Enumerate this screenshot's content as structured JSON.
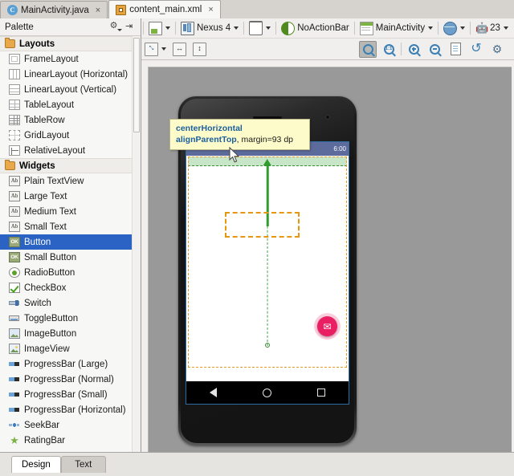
{
  "editor_tabs": [
    {
      "label": "MainActivity.java",
      "icon": "java-class-icon",
      "active": false,
      "close": "×"
    },
    {
      "label": "content_main.xml",
      "icon": "xml-layout-icon",
      "active": true,
      "close": "×"
    }
  ],
  "palette": {
    "title": "Palette",
    "gear_icon": "⚙",
    "collapse_icon": "⇥",
    "groups": [
      {
        "label": "Layouts",
        "items": [
          {
            "label": "FrameLayout",
            "icon": "framelayout-icon",
            "style": "ic-frame",
            "glyph": ""
          },
          {
            "label": "LinearLayout (Horizontal)",
            "icon": "linearlayout-horizontal-icon",
            "style": "ic-linh",
            "glyph": ""
          },
          {
            "label": "LinearLayout (Vertical)",
            "icon": "linearlayout-vertical-icon",
            "style": "ic-linv",
            "glyph": ""
          },
          {
            "label": "TableLayout",
            "icon": "tablelayout-icon",
            "style": "ic-tablay",
            "glyph": ""
          },
          {
            "label": "TableRow",
            "icon": "tablerow-icon",
            "style": "ic-tabrow",
            "glyph": ""
          },
          {
            "label": "GridLayout",
            "icon": "gridlayout-icon",
            "style": "ic-grid",
            "glyph": ""
          },
          {
            "label": "RelativeLayout",
            "icon": "relativelayout-icon",
            "style": "ic-rel",
            "glyph": ""
          }
        ]
      },
      {
        "label": "Widgets",
        "items": [
          {
            "label": "Plain TextView",
            "icon": "text-ab-icon",
            "style": "ic-ab",
            "glyph": "Ab"
          },
          {
            "label": "Large Text",
            "icon": "text-ab-icon",
            "style": "ic-ab",
            "glyph": "Ab"
          },
          {
            "label": "Medium Text",
            "icon": "text-ab-icon",
            "style": "ic-ab",
            "glyph": "Ab"
          },
          {
            "label": "Small Text",
            "icon": "text-ab-icon",
            "style": "ic-ab",
            "glyph": "Ab"
          },
          {
            "label": "Button",
            "icon": "button-ok-icon",
            "style": "ic-ok",
            "glyph": "OK",
            "selected": true
          },
          {
            "label": "Small Button",
            "icon": "button-ok-icon",
            "style": "ic-ok",
            "glyph": "OK"
          },
          {
            "label": "RadioButton",
            "icon": "radiobutton-icon",
            "style": "ic-radio",
            "glyph": ""
          },
          {
            "label": "CheckBox",
            "icon": "checkbox-icon",
            "style": "ic-check",
            "glyph": ""
          },
          {
            "label": "Switch",
            "icon": "switch-icon",
            "style": "ic-switch",
            "glyph": ""
          },
          {
            "label": "ToggleButton",
            "icon": "togglebutton-icon",
            "style": "ic-toggle",
            "glyph": ""
          },
          {
            "label": "ImageButton",
            "icon": "imagebutton-icon",
            "style": "ic-imgbtn",
            "glyph": ""
          },
          {
            "label": "ImageView",
            "icon": "imageview-icon",
            "style": "ic-imgview",
            "glyph": ""
          },
          {
            "label": "ProgressBar (Large)",
            "icon": "progressbar-icon",
            "style": "ic-prog",
            "glyph": ""
          },
          {
            "label": "ProgressBar (Normal)",
            "icon": "progressbar-icon",
            "style": "ic-prog",
            "glyph": ""
          },
          {
            "label": "ProgressBar (Small)",
            "icon": "progressbar-icon",
            "style": "ic-prog",
            "glyph": ""
          },
          {
            "label": "ProgressBar (Horizontal)",
            "icon": "progressbar-icon",
            "style": "ic-prog",
            "glyph": ""
          },
          {
            "label": "SeekBar",
            "icon": "seekbar-icon",
            "style": "ic-seek",
            "glyph": ""
          },
          {
            "label": "RatingBar",
            "icon": "ratingbar-icon",
            "style": "ic-rating",
            "glyph": "★"
          }
        ]
      }
    ]
  },
  "design_toolbar": {
    "layout_variant": {
      "label": "",
      "icon": "layout-variant-icon",
      "caret": true
    },
    "device": {
      "label": "Nexus 4",
      "icon": "device-icon",
      "caret": true
    },
    "orientation": {
      "label": "",
      "icon": "orientation-icon",
      "caret": true
    },
    "theme": {
      "label": "NoActionBar",
      "icon": "theme-icon",
      "caret": false
    },
    "activity": {
      "label": "MainActivity",
      "icon": "activity-icon",
      "caret": true
    },
    "locale": {
      "label": "",
      "icon": "locale-globe-icon",
      "caret": true
    },
    "api_level": {
      "label": "23",
      "icon": "android-api-icon",
      "caret": true
    }
  },
  "view_toolbar": {
    "zoom_fit": {
      "icon": "zoom-fit-icon",
      "glyph": "⤡",
      "caret": true
    },
    "fit_width": {
      "icon": "fit-width-icon",
      "glyph": "↔"
    },
    "fit_height": {
      "icon": "fit-height-icon",
      "glyph": "↕"
    },
    "zoom_fit_screen": {
      "icon": "zoom-to-fit-icon",
      "pressed": true
    },
    "zoom_actual": {
      "icon": "zoom-actual-size-icon",
      "glyph": "1:1"
    },
    "zoom_in": {
      "icon": "zoom-in-icon"
    },
    "zoom_out": {
      "icon": "zoom-out-icon"
    },
    "show_xml": {
      "icon": "document-icon"
    },
    "refresh": {
      "icon": "refresh-icon",
      "glyph": "↺"
    },
    "settings": {
      "icon": "gear-icon",
      "glyph": "⚙"
    }
  },
  "preview": {
    "status_time": "6:00",
    "tooltip": {
      "line1": "centerHorizontal",
      "line2_key": "alignParentTop",
      "line2_value": ", margin=93 dp"
    },
    "fab_icon": "✉",
    "nav": {
      "back": "back-triangle-icon",
      "home": "home-circle-icon",
      "recent": "recents-square-icon"
    },
    "colors": {
      "canvas_bg": "#999999",
      "status_bar": "#5c6b9c",
      "screen_border": "#2e6da4",
      "guide_green": "#2f9e2f",
      "bounds_orange": "#e49b2b",
      "drag_orange": "#e8960f",
      "fab_pink": "#e91e63",
      "tooltip_bg": "#fdfbc9",
      "selection_blue": "#2b63c4"
    }
  },
  "bottom_tabs": [
    {
      "label": "Design",
      "active": true
    },
    {
      "label": "Text",
      "active": false
    }
  ]
}
